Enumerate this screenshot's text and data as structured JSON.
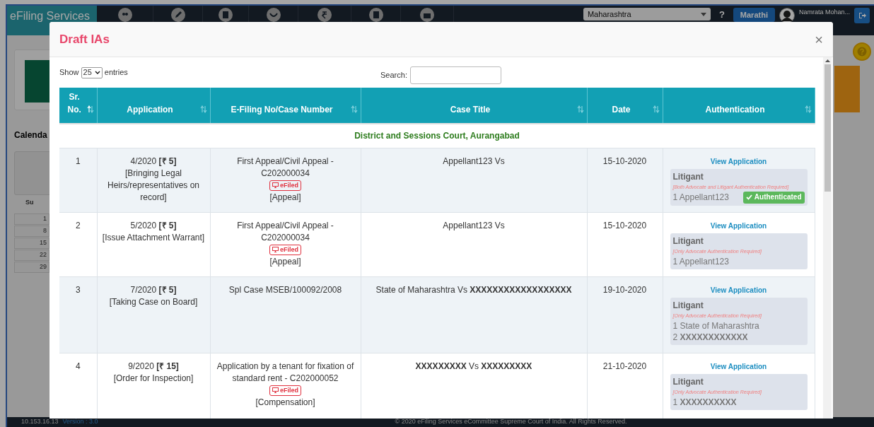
{
  "background": {
    "brand": "eFiling Services",
    "state_select": "Maharashtra",
    "help": "?",
    "language_button": "Marathi",
    "user_name": "Namrata Mohan...",
    "calendar_title": "Calenda",
    "weekday": "Su",
    "days": [
      "1",
      "8",
      "15",
      "22",
      "29"
    ],
    "footer_ip": "10.153.16.13",
    "footer_version": "Version : 3.0",
    "footer_copyright": "© 2020 eFiling Services eCommittee Supreme Court of India. All Rights Reserved."
  },
  "modal": {
    "title": "Draft IAs",
    "close": "×",
    "show_label": "Show",
    "page_length": "25",
    "entries_label": "entries",
    "search_label": "Search:",
    "columns": [
      {
        "label": "Sr. No.",
        "sorted": true
      },
      {
        "label": "Application",
        "sorted": false
      },
      {
        "label": "E-Filing No/Case Number",
        "sorted": false
      },
      {
        "label": "Case Title",
        "sorted": false
      },
      {
        "label": "Date",
        "sorted": false
      },
      {
        "label": "Authentication",
        "sorted": false
      }
    ],
    "group": "District and Sessions Court, Aurangabad",
    "rows": [
      {
        "sr": "1",
        "application": "4/2020 **[₹ 5]**",
        "description": "[Bringing Legal Heirs/representatives on record]",
        "case_number": "First Appeal/Civil Appeal - C202000034",
        "efiled": true,
        "efiled_label": "eFiled",
        "category": "[Appeal]",
        "case_title": "Appellant123 Vs",
        "date": "15-10-2020",
        "link": "View Application",
        "auth_title": "Litigant",
        "auth_note": "[Both Advocate and Litigant Authentication Required]",
        "parties": [
          "1 Appellant123"
        ],
        "authenticated": true,
        "authenticated_label": "Authenticated"
      },
      {
        "sr": "2",
        "application": "5/2020 **[₹ 5]**",
        "description": "[Issue Attachment Warrant]",
        "case_number": "First Appeal/Civil Appeal - C202000034",
        "efiled": true,
        "efiled_label": "eFiled",
        "category": "[Appeal]",
        "case_title": "Appellant123 Vs",
        "date": "15-10-2020",
        "link": "View Application",
        "auth_title": "Litigant",
        "auth_note": "[Only Advocate Authentication Required]",
        "parties": [
          "1 Appellant123"
        ],
        "authenticated": false
      },
      {
        "sr": "3",
        "application": "7/2020 **[₹ 5]**",
        "description": "[Taking Case on Board]",
        "case_number": "Spl Case MSEB/100092/2008",
        "efiled": false,
        "case_title": "State of Maharashtra Vs **XXXXXXXXXXXXXXXXXX**",
        "date": "19-10-2020",
        "link": "View Application",
        "auth_title": "Litigant",
        "auth_note": "[Only Advocate Authentication Required]",
        "parties": [
          "1 State of Maharashtra",
          "2 **XXXXXXXXXXXX**"
        ],
        "authenticated": false
      },
      {
        "sr": "4",
        "application": "9/2020 **[₹ 15]**",
        "description": "[Order for Inspection]",
        "case_number": "Application by a tenant for fixation of standard rent - C202000052",
        "efiled": true,
        "efiled_label": "eFiled",
        "category": "[Compensation]",
        "case_title": "**XXXXXXXXX** Vs **XXXXXXXXX**",
        "date": "21-10-2020",
        "link": "View Application",
        "auth_title": "Litigant",
        "auth_note": "[Only Advocate Authentication Required]",
        "parties": [
          "1 **XXXXXXXXXX**"
        ],
        "authenticated": false
      }
    ]
  }
}
